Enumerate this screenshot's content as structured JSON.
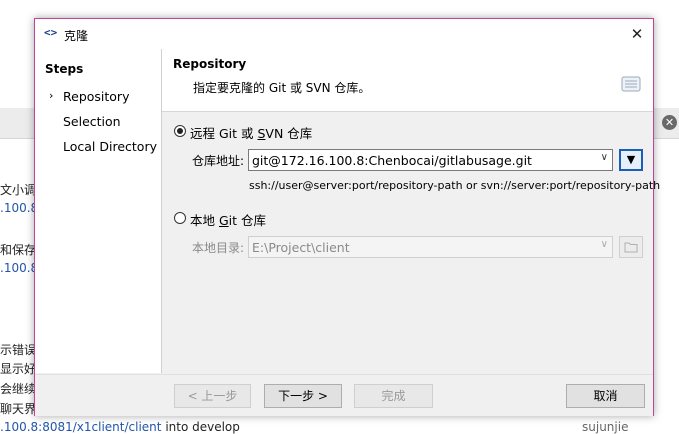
{
  "background": {
    "fragments": [
      {
        "text": "文小调整",
        "link": false
      },
      {
        "text": ".100.8",
        "link": true
      },
      {
        "text": "和保存",
        "link": false
      },
      {
        "text": ".100.8",
        "link": true
      },
      {
        "text": "示错误",
        "link": false
      },
      {
        "text": "显示好友",
        "link": false
      },
      {
        "text": "会继续",
        "link": false
      },
      {
        "text": "聊天界面",
        "link": false
      }
    ],
    "bottom_link": ".100.8:8081/x1client/client",
    "bottom_text": " into develop",
    "bottom_user": "sujunjie"
  },
  "dialog": {
    "title": "克隆",
    "title_icon": "<>",
    "close_glyph": "✕"
  },
  "sidebar": {
    "title": "Steps",
    "items": [
      {
        "label": "Repository",
        "current": true
      },
      {
        "label": "Selection",
        "current": false
      },
      {
        "label": "Local Directory",
        "current": false
      }
    ]
  },
  "header": {
    "title": "Repository",
    "description": "指定要克隆的 Git 或 SVN 仓库。"
  },
  "remote": {
    "radio_label_pre": "远程 Git 或 ",
    "radio_label_u": "S",
    "radio_label_post": "VN 仓库",
    "selected": true,
    "field_label": "仓库地址:",
    "value": "git@172.16.100.8:Chenbocai/gitlabusage.git",
    "hint": "ssh://user@server:port/repository-path or svn://server:port/repository-path"
  },
  "local": {
    "radio_label_pre": "本地 ",
    "radio_label_u": "G",
    "radio_label_post": "it 仓库",
    "selected": false,
    "field_label": "本地目录:",
    "value": "E:\\Project\\client"
  },
  "footer": {
    "back": "< 上一步",
    "next": "下一步 >",
    "finish": "完成",
    "cancel": "取消"
  }
}
